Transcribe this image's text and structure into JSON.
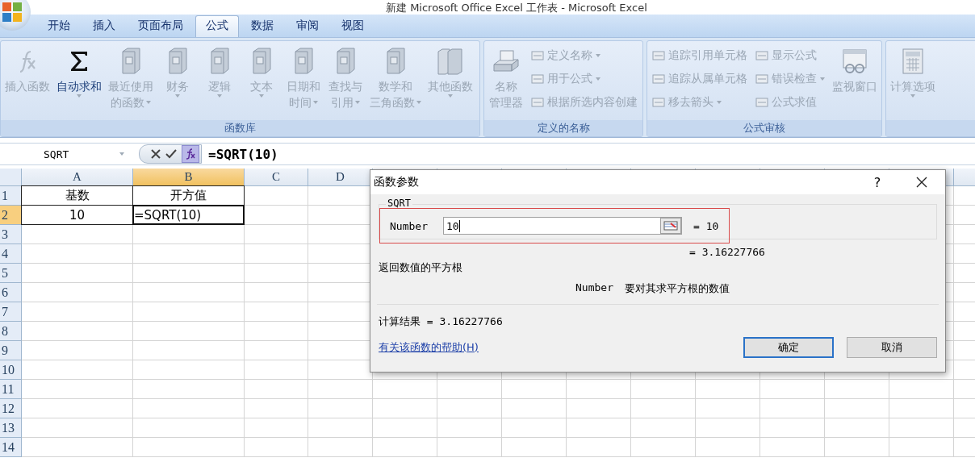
{
  "window": {
    "title": "新建 Microsoft Office Excel 工作表 - Microsoft Excel"
  },
  "ribbon_tabs": [
    {
      "label": "开始",
      "selected": false
    },
    {
      "label": "插入",
      "selected": false
    },
    {
      "label": "页面布局",
      "selected": false
    },
    {
      "label": "公式",
      "selected": true
    },
    {
      "label": "数据",
      "selected": false
    },
    {
      "label": "审阅",
      "selected": false
    },
    {
      "label": "视图",
      "selected": false
    }
  ],
  "ribbon_groups": [
    {
      "label": "函数库",
      "items": [
        {
          "kind": "large",
          "lines": [
            "插入函数"
          ],
          "dropdown": false,
          "disabled": true
        },
        {
          "kind": "large",
          "lines": [
            "自动求和"
          ],
          "dropdown": true,
          "disabled": false
        },
        {
          "kind": "large",
          "lines": [
            "最近使用",
            "的函数"
          ],
          "dropdown": true,
          "disabled": true
        },
        {
          "kind": "large",
          "lines": [
            "财务"
          ],
          "dropdown": true,
          "disabled": true
        },
        {
          "kind": "large",
          "lines": [
            "逻辑"
          ],
          "dropdown": true,
          "disabled": true
        },
        {
          "kind": "large",
          "lines": [
            "文本"
          ],
          "dropdown": true,
          "disabled": true
        },
        {
          "kind": "large",
          "lines": [
            "日期和",
            "时间"
          ],
          "dropdown": true,
          "disabled": true
        },
        {
          "kind": "large",
          "lines": [
            "查找与",
            "引用"
          ],
          "dropdown": true,
          "disabled": true
        },
        {
          "kind": "large",
          "lines": [
            "数学和",
            "三角函数"
          ],
          "dropdown": true,
          "disabled": true
        },
        {
          "kind": "large",
          "lines": [
            "其他函数"
          ],
          "dropdown": true,
          "disabled": true
        }
      ]
    },
    {
      "label": "定义的名称",
      "items": [
        {
          "kind": "large",
          "lines": [
            "名称",
            "管理器"
          ],
          "dropdown": false,
          "disabled": true
        },
        {
          "kind": "column",
          "items": [
            {
              "label": "定义名称",
              "dropdown": true,
              "disabled": true
            },
            {
              "label": "用于公式",
              "dropdown": true,
              "disabled": true
            },
            {
              "label": "根据所选内容创建",
              "dropdown": false,
              "disabled": true
            }
          ]
        }
      ]
    },
    {
      "label": "公式审核",
      "items": [
        {
          "kind": "column",
          "items": [
            {
              "label": "追踪引用单元格",
              "dropdown": false,
              "disabled": true
            },
            {
              "label": "追踪从属单元格",
              "dropdown": false,
              "disabled": true
            },
            {
              "label": "移去箭头",
              "dropdown": true,
              "disabled": true
            }
          ]
        },
        {
          "kind": "column",
          "items": [
            {
              "label": "显示公式",
              "dropdown": false,
              "disabled": true
            },
            {
              "label": "错误检查",
              "dropdown": true,
              "disabled": true
            },
            {
              "label": "公式求值",
              "dropdown": false,
              "disabled": true
            }
          ]
        },
        {
          "kind": "large",
          "lines": [
            "监视窗口"
          ],
          "dropdown": false,
          "disabled": true
        }
      ]
    },
    {
      "items": [
        {
          "kind": "large",
          "lines": [
            "计算选项"
          ],
          "dropdown": true,
          "disabled": true
        }
      ]
    }
  ],
  "formula_bar": {
    "name_box": "SQRT",
    "formula": "=SQRT(10)"
  },
  "sheet": {
    "columns": [
      {
        "label": "A",
        "selected": false
      },
      {
        "label": "B",
        "selected": true
      },
      {
        "label": "C",
        "selected": false
      },
      {
        "label": "D",
        "selected": false
      }
    ],
    "rows": [
      {
        "label": "1",
        "selected": false,
        "cells": [
          "基数",
          "开方值"
        ]
      },
      {
        "label": "2",
        "selected": true,
        "cells": [
          "10",
          "=SQRT(10)"
        ]
      },
      {
        "label": "3",
        "selected": false,
        "cells": []
      },
      {
        "label": "4",
        "selected": false,
        "cells": []
      },
      {
        "label": "5",
        "selected": false,
        "cells": []
      },
      {
        "label": "6",
        "selected": false,
        "cells": []
      },
      {
        "label": "7",
        "selected": false,
        "cells": []
      },
      {
        "label": "8",
        "selected": false,
        "cells": []
      },
      {
        "label": "9",
        "selected": false,
        "cells": []
      },
      {
        "label": "10",
        "selected": false,
        "cells": []
      },
      {
        "label": "11",
        "selected": false,
        "cells": []
      },
      {
        "label": "12",
        "selected": false,
        "cells": []
      },
      {
        "label": "13",
        "selected": false,
        "cells": []
      },
      {
        "label": "14",
        "selected": false,
        "cells": []
      }
    ]
  },
  "dialog": {
    "title": "函数参数",
    "help": "?",
    "function_name": "SQRT",
    "argument": {
      "label": "Number",
      "value": "10",
      "result": "=  10"
    },
    "function_result": "=  3.16227766",
    "description": "返回数值的平方根",
    "argument_help": {
      "name": "Number",
      "text": "要对其求平方根的数值"
    },
    "formula_result": "计算结果 =  3.16227766",
    "help_link": "有关该函数的帮助(H)",
    "buttons": [
      {
        "label": "确定",
        "default": true
      },
      {
        "label": "取消",
        "default": false
      }
    ]
  }
}
